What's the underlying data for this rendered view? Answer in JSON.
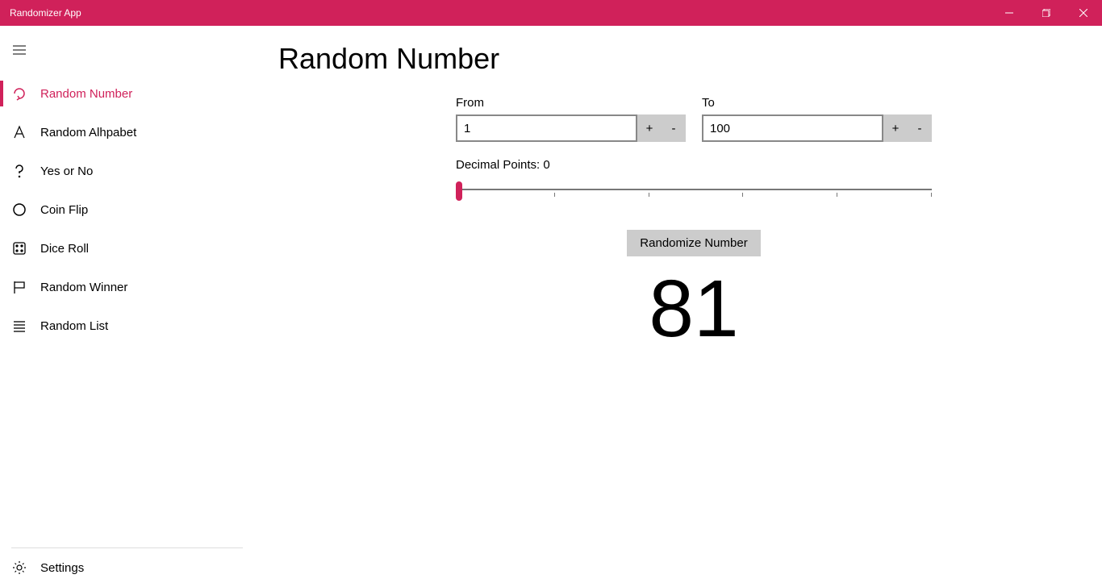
{
  "titlebar": {
    "title": "Randomizer App"
  },
  "sidebar": {
    "items": [
      {
        "label": "Random Number",
        "active": true
      },
      {
        "label": "Random Alhpabet",
        "active": false
      },
      {
        "label": "Yes or No",
        "active": false
      },
      {
        "label": "Coin Flip",
        "active": false
      },
      {
        "label": "Dice Roll",
        "active": false
      },
      {
        "label": "Random Winner",
        "active": false
      },
      {
        "label": "Random List",
        "active": false
      }
    ],
    "settings_label": "Settings"
  },
  "main": {
    "title": "Random Number",
    "from_label": "From",
    "from_value": "1",
    "to_label": "To",
    "to_value": "100",
    "plus": "+",
    "minus": "-",
    "decimal_label": "Decimal Points: 0",
    "decimal_value": 0,
    "randomize_label": "Randomize Number",
    "result": "81"
  }
}
